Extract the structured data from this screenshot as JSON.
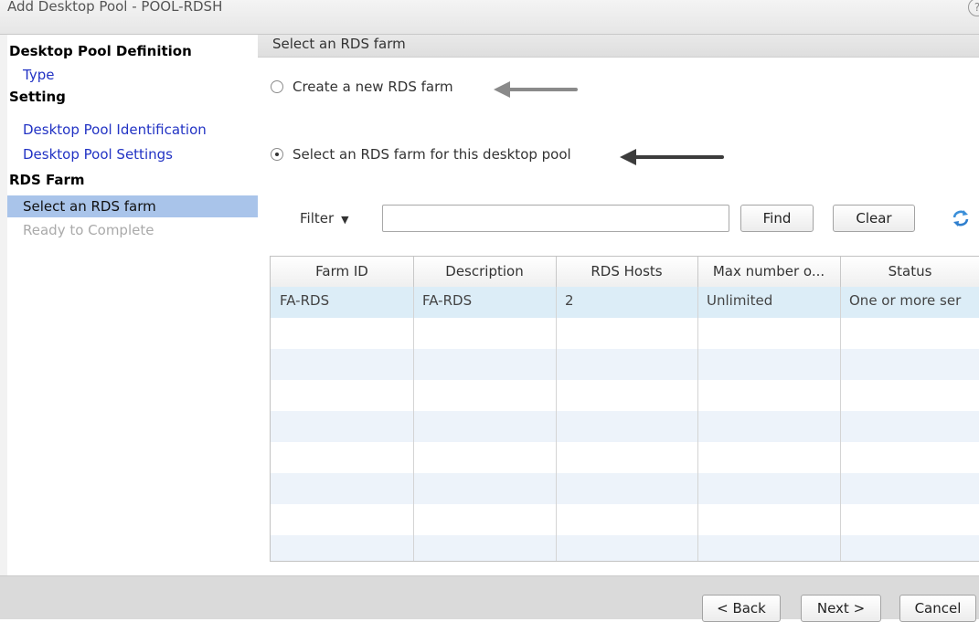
{
  "window": {
    "title": "Add Desktop Pool - POOL-RDSH",
    "help_label": "?"
  },
  "sidebar": {
    "items": [
      {
        "label": "Desktop Pool Definition",
        "kind": "header"
      },
      {
        "label": "Type",
        "kind": "link"
      },
      {
        "label": "Setting",
        "kind": "header"
      },
      {
        "label": "Desktop Pool Identification",
        "kind": "link"
      },
      {
        "label": "Desktop Pool Settings",
        "kind": "link"
      },
      {
        "label": "RDS Farm",
        "kind": "header"
      },
      {
        "label": "Select an RDS farm",
        "kind": "selected"
      },
      {
        "label": "Ready to Complete",
        "kind": "disabled"
      }
    ]
  },
  "main": {
    "section_title": "Select an RDS farm",
    "options": {
      "create": {
        "label": "Create a new RDS farm",
        "checked": false
      },
      "select": {
        "label": "Select an RDS farm for this desktop pool",
        "checked": true
      }
    },
    "filter": {
      "label": "Filter",
      "value": "",
      "find_label": "Find",
      "clear_label": "Clear",
      "refresh_icon": "refresh-icon"
    },
    "table": {
      "columns": [
        "Farm ID",
        "Description",
        "RDS Hosts",
        "Max number o...",
        "Status"
      ],
      "rows": [
        [
          "FA-RDS",
          "FA-RDS",
          "2",
          "Unlimited",
          "One or more ser"
        ]
      ]
    }
  },
  "footer": {
    "back_label": "< Back",
    "next_label": "Next >",
    "cancel_label": "Cancel"
  },
  "colors": {
    "link": "#2233c4",
    "selected_nav": "#a9c4ea",
    "selected_row": "#dcedf7",
    "alt_row": "#edf3fa"
  }
}
